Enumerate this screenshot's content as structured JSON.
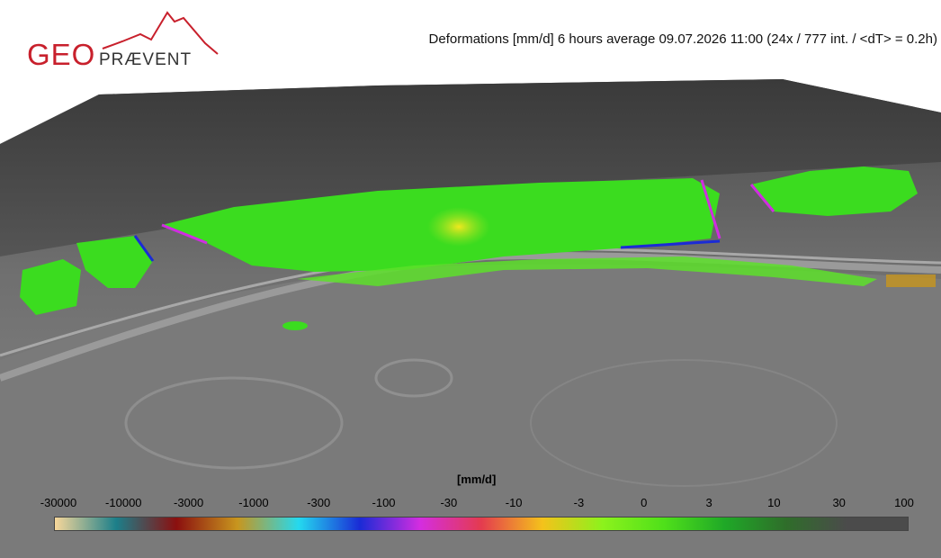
{
  "title": "Deformations [mm/d] 6 hours average 09.07.2026 11:00 (24x / 777 int. / <dT> = 0.2h)",
  "logo": {
    "geo": "GEO",
    "praevent": "PRÆVENT",
    "color": "#c8202c"
  },
  "legend": {
    "unit": "[mm/d]",
    "ticks": [
      "-30000",
      "-10000",
      "-3000",
      "-1000",
      "-300",
      "-100",
      "-30",
      "-10",
      "-3",
      "0",
      "3",
      "10",
      "30",
      "100"
    ],
    "colors": [
      "#f7d79a",
      "#1c7f8a",
      "#8b0f0f",
      "#c8961e",
      "#24d9ef",
      "#1a2bd6",
      "#d42de0",
      "#e43b4f",
      "#f4c21b",
      "#8cf21c",
      "#4fe01a",
      "#1fa827",
      "#2f6d2a",
      "#4b4b4b"
    ]
  },
  "scene": {
    "terrain_color": "#6b6b6b",
    "stable_color": "#22d41c",
    "hotspot_color": "#f0e020"
  }
}
